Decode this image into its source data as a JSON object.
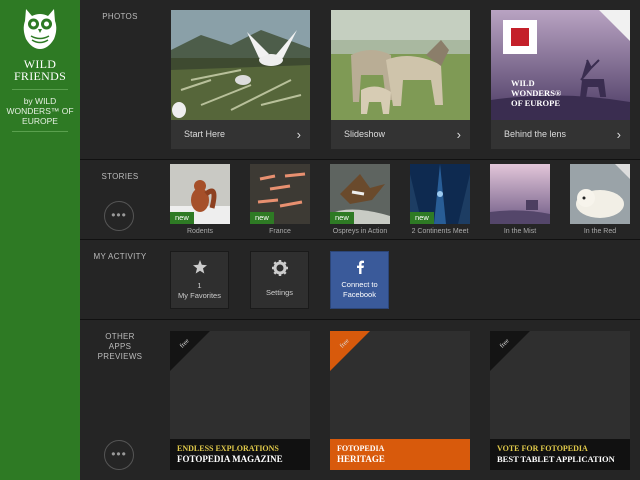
{
  "sidebar": {
    "brand_line1": "WILD",
    "brand_line2": "FRIENDS",
    "byline1": "by WILD",
    "byline2": "WONDERS™ OF",
    "byline3": "EUROPE",
    "accent": "#2e7a24"
  },
  "sections": {
    "photos": "PHOTOS",
    "stories": "STORIES",
    "activity": "MY ACTIVITY",
    "other1": "OTHER",
    "other2": "APPS",
    "other3": "PREVIEWS",
    "more": "•••"
  },
  "photos": [
    {
      "caption": "Start Here",
      "chevron": "›"
    },
    {
      "caption": "Slideshow",
      "chevron": "›"
    },
    {
      "caption": "Behind the lens",
      "chevron": "›",
      "overlay1": "WILD",
      "overlay2": "WONDERS®",
      "overlay3": "OF EUROPE"
    }
  ],
  "stories": [
    {
      "label": "Rodents",
      "badge": "new"
    },
    {
      "label": "France",
      "badge": "new"
    },
    {
      "label": "Ospreys in Action",
      "badge": "new"
    },
    {
      "label": "2 Continents Meet",
      "badge": "new"
    },
    {
      "label": "In the Mist",
      "badge": ""
    },
    {
      "label": "In the Red",
      "badge": ""
    }
  ],
  "activity": {
    "favorites_count": "1",
    "favorites_label": "My Favorites",
    "settings_label": "Settings",
    "facebook_line1": "Connect to",
    "facebook_line2": "Facebook",
    "facebook_color": "#3a5a9a"
  },
  "apps": [
    {
      "ribbon": "free",
      "line1": "ENDLESS EXPLORATIONS",
      "line2": "FOTOPEDIA MAGAZINE",
      "banner_color": "#111111"
    },
    {
      "ribbon": "free",
      "line1": "FOTOPEDIA",
      "line2": "HERITAGE",
      "banner_color": "#d85a0c"
    },
    {
      "ribbon": "free",
      "line1": "VOTE FOR FOTOPEDIA",
      "line2": "BEST TABLET APPLICATION",
      "banner_color": "#111111"
    }
  ]
}
